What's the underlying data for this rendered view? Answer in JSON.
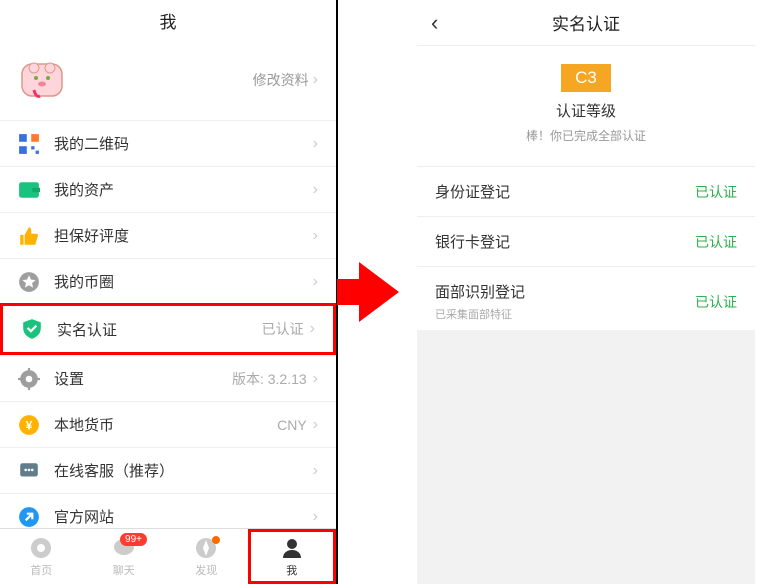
{
  "left": {
    "title": "我",
    "edit_profile": "修改资料",
    "menu": [
      {
        "label": "我的二维码",
        "right": ""
      },
      {
        "label": "我的资产",
        "right": ""
      },
      {
        "label": "担保好评度",
        "right": ""
      },
      {
        "label": "我的币圈",
        "right": ""
      },
      {
        "label": "实名认证",
        "right": "已认证"
      },
      {
        "label": "设置",
        "right": "版本: 3.2.13"
      },
      {
        "label": "本地货币",
        "right": "CNY"
      },
      {
        "label": "在线客服（推荐）",
        "right": ""
      },
      {
        "label": "官方网站",
        "right": ""
      }
    ],
    "tabs": [
      {
        "label": "首页",
        "badge": ""
      },
      {
        "label": "聊天",
        "badge": "99+"
      },
      {
        "label": "发现",
        "badge": ""
      },
      {
        "label": "我",
        "badge": ""
      }
    ]
  },
  "right": {
    "title": "实名认证",
    "cert_badge": "C3",
    "cert_level": "认证等级",
    "cert_sub": "棒！你已完成全部认证",
    "items": [
      {
        "title": "身份证登记",
        "sub": "",
        "status": "已认证"
      },
      {
        "title": "银行卡登记",
        "sub": "",
        "status": "已认证"
      },
      {
        "title": "面部识别登记",
        "sub": "已采集面部特征",
        "status": "已认证"
      }
    ]
  }
}
